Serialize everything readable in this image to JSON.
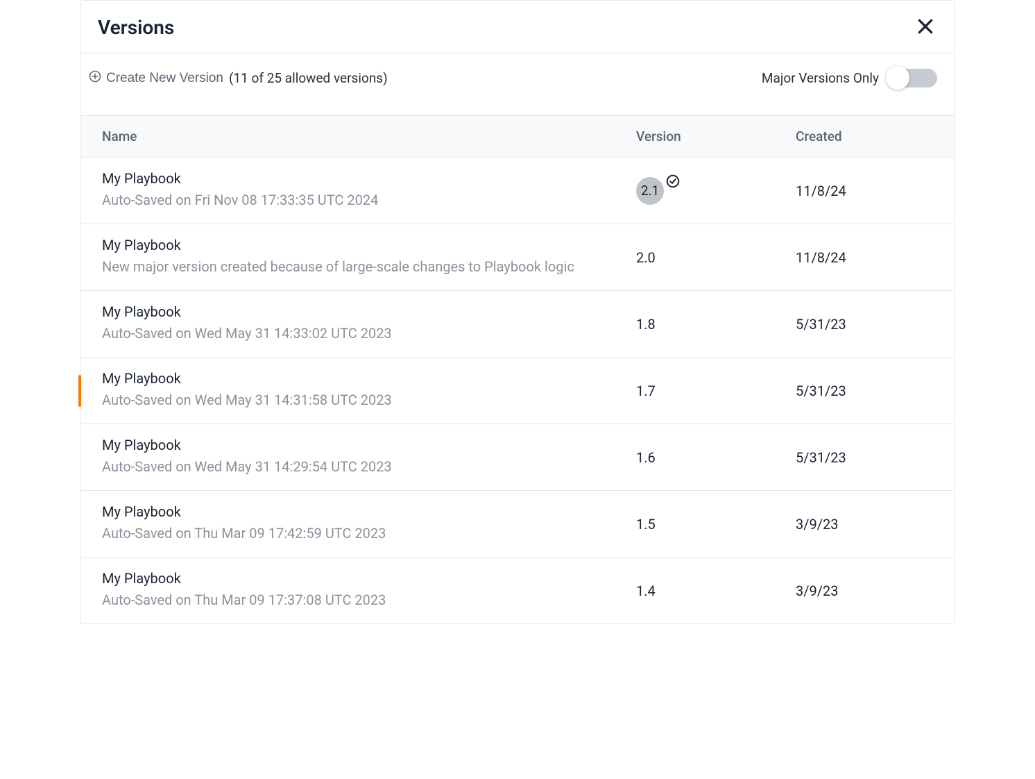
{
  "header": {
    "title": "Versions"
  },
  "toolbar": {
    "create_label": "Create New Version",
    "limit_text": "(11 of 25 allowed versions)",
    "toggle_label": "Major Versions Only"
  },
  "columns": {
    "name": "Name",
    "version": "Version",
    "created": "Created"
  },
  "rows": [
    {
      "name": "My Playbook",
      "desc": "Auto-Saved on Fri Nov 08 17:33:35 UTC 2024",
      "version": "2.1",
      "created": "11/8/24",
      "highlighted": true,
      "checked": true
    },
    {
      "name": "My Playbook",
      "desc": "New major version created because of large-scale changes to Playbook logic",
      "version": "2.0",
      "created": "11/8/24"
    },
    {
      "name": "My Playbook",
      "desc": "Auto-Saved on Wed May 31 14:33:02 UTC 2023",
      "version": "1.8",
      "created": "5/31/23"
    },
    {
      "name": "My Playbook",
      "desc": "Auto-Saved on Wed May 31 14:31:58 UTC 2023",
      "version": "1.7",
      "created": "5/31/23",
      "marker": true
    },
    {
      "name": "My Playbook",
      "desc": "Auto-Saved on Wed May 31 14:29:54 UTC 2023",
      "version": "1.6",
      "created": "5/31/23"
    },
    {
      "name": "My Playbook",
      "desc": "Auto-Saved on Thu Mar 09 17:42:59 UTC 2023",
      "version": "1.5",
      "created": "3/9/23"
    },
    {
      "name": "My Playbook",
      "desc": "Auto-Saved on Thu Mar 09 17:37:08 UTC 2023",
      "version": "1.4",
      "created": "3/9/23"
    }
  ]
}
